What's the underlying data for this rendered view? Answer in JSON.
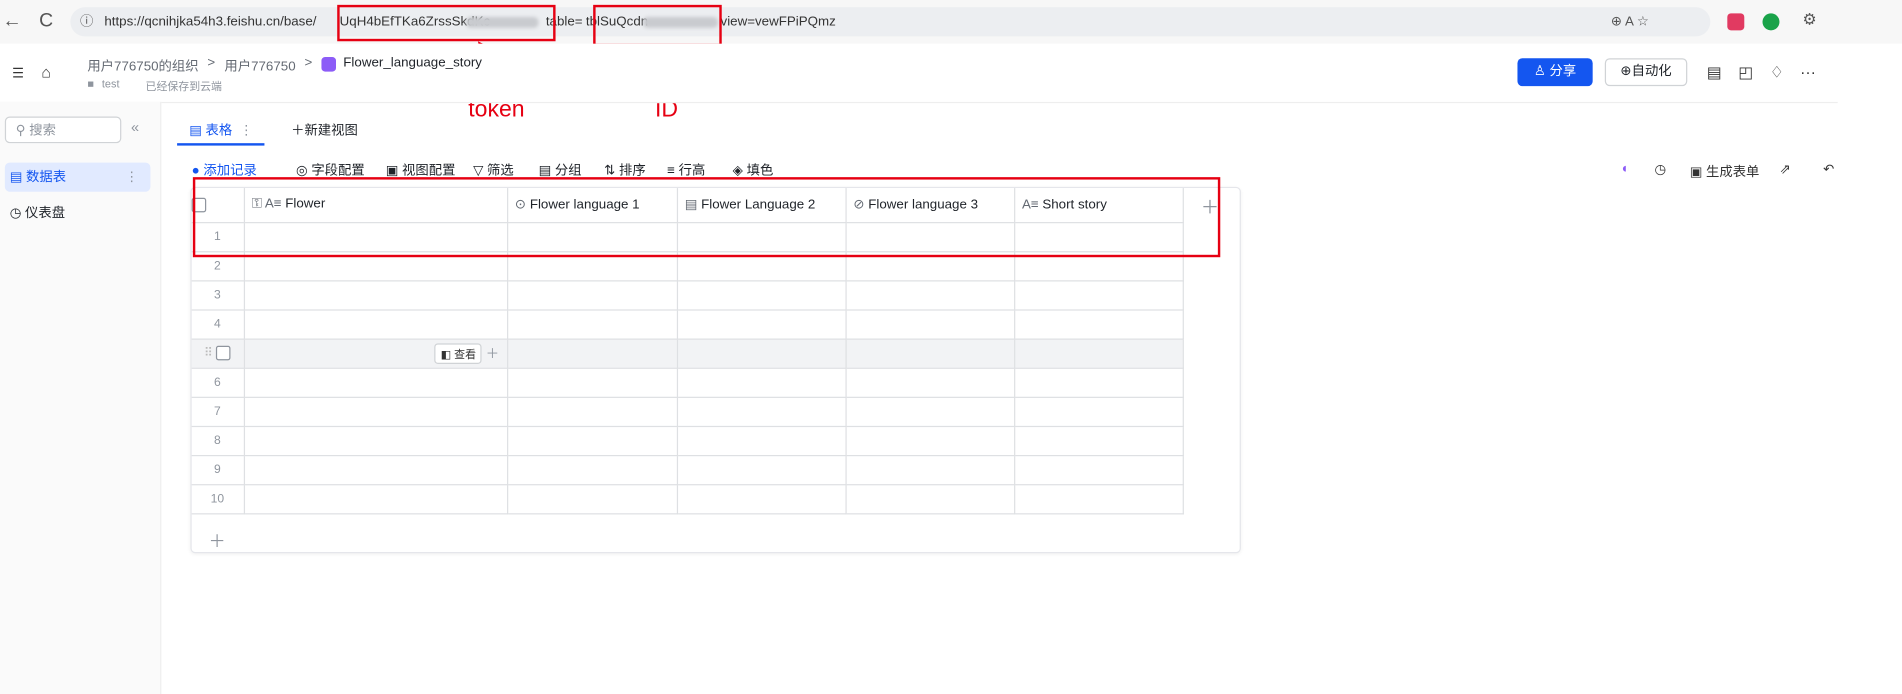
{
  "browser": {
    "back_icon": "←",
    "reload_icon": "C",
    "url_prefix": "https://qcnihjka54h3.feishu.cn/base/",
    "url_token": "UqH4bEfTKa6ZrssSkdKc",
    "url_mid": "table=",
    "url_id": "tblSuQcdn",
    "url_tail": "view=vewFPiPQmz",
    "right_icons": "⊕  A ☆"
  },
  "annotations": {
    "token_label": "token",
    "id_label": "ID",
    "color": "#e60012"
  },
  "header": {
    "org": "用户776750的组织",
    "sep": ">",
    "user": "用户776750",
    "base_name": "Flower_language_story",
    "folder": "test",
    "saved": "已经保存到云端",
    "share_label": "分享",
    "auto_label": "自动化",
    "more_icon": "···"
  },
  "sidebar": {
    "search_placeholder": "搜索",
    "collapse_icon": "«",
    "items": [
      {
        "label": "数据表",
        "active": true
      },
      {
        "label": "仪表盘",
        "active": false
      }
    ]
  },
  "tabs": {
    "table_tab": "表格",
    "new_view": "新建视图"
  },
  "toolbar": {
    "add_record": "添加记录",
    "field_config": "字段配置",
    "view_config": "视图配置",
    "filter": "筛选",
    "group": "分组",
    "sort": "排序",
    "row_height": "行高",
    "fill_color": "填色",
    "generate_form": "生成表单"
  },
  "grid": {
    "columns": [
      {
        "label": "Flower",
        "icon": "text-icon"
      },
      {
        "label": "Flower language 1",
        "icon": "single-select-icon"
      },
      {
        "label": "Flower Language 2",
        "icon": "multi-select-icon"
      },
      {
        "label": "Flower language 3",
        "icon": "attachment-icon"
      },
      {
        "label": "Short story",
        "icon": "text-icon"
      }
    ],
    "rows": [
      "1",
      "2",
      "3",
      "4",
      "",
      "6",
      "7",
      "8",
      "9",
      "10"
    ],
    "expand_label": "查看"
  },
  "colors": {
    "accent": "#1456f0",
    "annotation": "#e60012"
  }
}
